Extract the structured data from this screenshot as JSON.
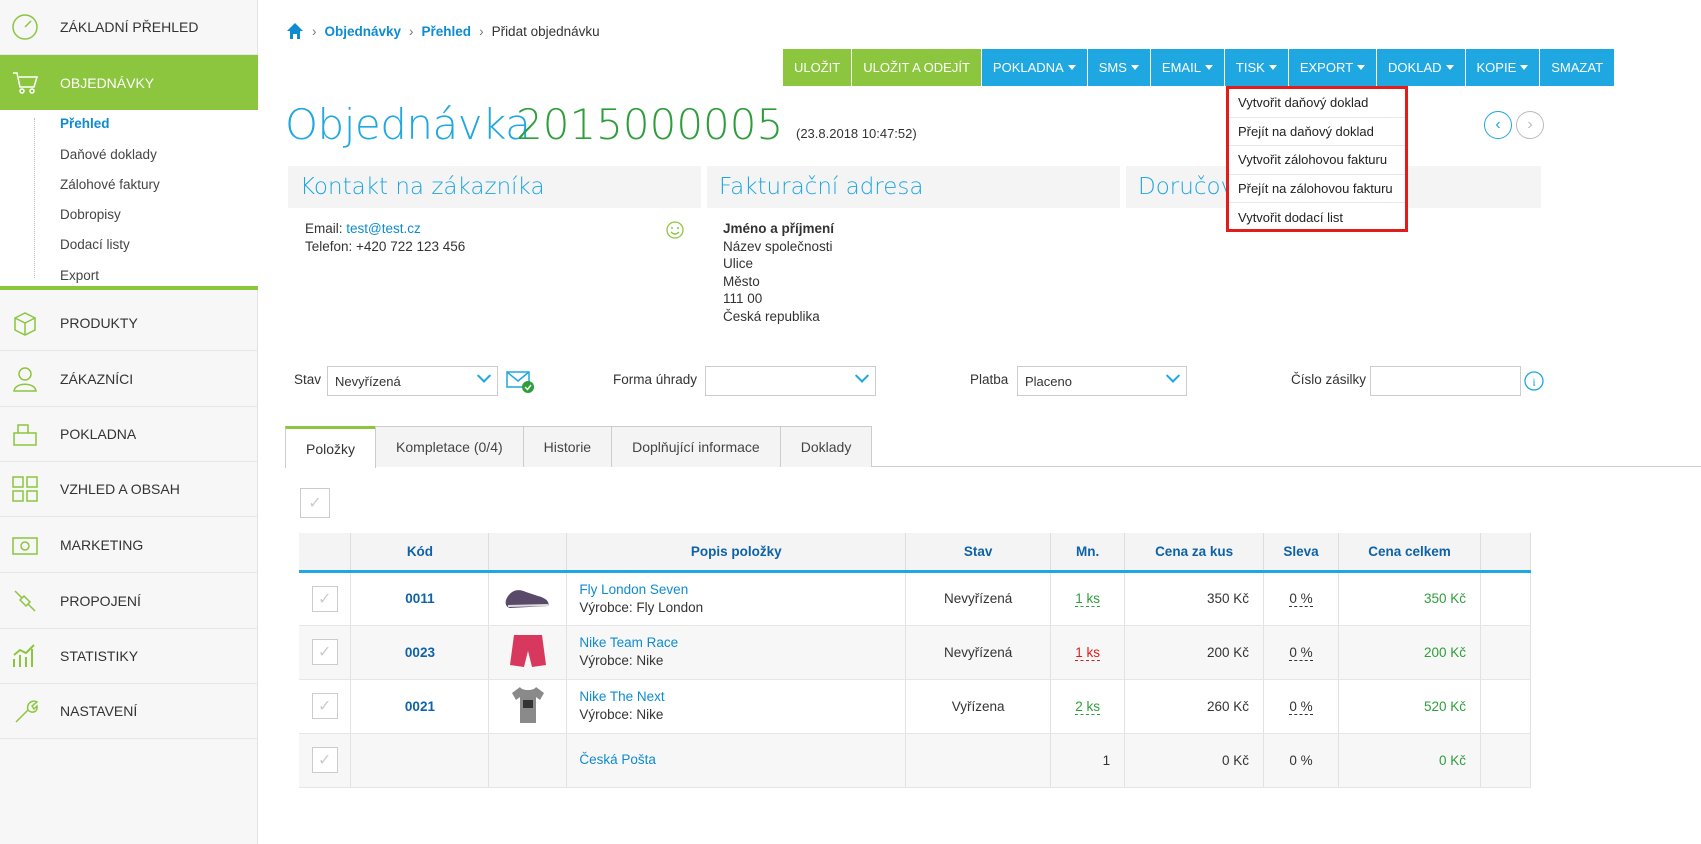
{
  "sidebar": {
    "items": [
      {
        "label": "ZÁKLADNÍ PŘEHLED",
        "icon": "gauge-icon"
      },
      {
        "label": "OBJEDNÁVKY",
        "icon": "cart-icon"
      },
      {
        "label": "PRODUKTY",
        "icon": "box-icon"
      },
      {
        "label": "ZÁKAZNÍCI",
        "icon": "user-icon"
      },
      {
        "label": "POKLADNA",
        "icon": "cash-register-icon"
      },
      {
        "label": "VZHLED A OBSAH",
        "icon": "layout-grid-icon"
      },
      {
        "label": "MARKETING",
        "icon": "money-icon"
      },
      {
        "label": "PROPOJENÍ",
        "icon": "plug-icon"
      },
      {
        "label": "STATISTIKY",
        "icon": "bar-chart-icon"
      },
      {
        "label": "NASTAVENÍ",
        "icon": "wrench-icon"
      }
    ],
    "subitems": [
      "Přehled",
      "Daňové doklady",
      "Zálohové faktury",
      "Dobropisy",
      "Dodací listy",
      "Export"
    ]
  },
  "breadcrumb": {
    "home": "home-icon",
    "items": [
      "Objednávky",
      "Přehled",
      "Přidat objednávku"
    ]
  },
  "toolbar": {
    "buttons": [
      "ULOŽIT",
      "ULOŽIT A ODEJÍT",
      "POKLADNA",
      "SMS",
      "EMAIL",
      "TISK",
      "EXPORT",
      "DOKLAD",
      "KOPIE",
      "SMAZAT"
    ]
  },
  "dropdown": {
    "items": [
      "Vytvořit daňový doklad",
      "Přejít na daňový doklad",
      "Vytvořit zálohovou fakturu",
      "Přejít na zálohovou fakturu",
      "Vytvořit dodací list"
    ]
  },
  "order": {
    "title": "Objednávka",
    "number": "2015000005",
    "date": "(23.8.2018 10:47:52)"
  },
  "panels": {
    "contact": {
      "title": "Kontakt na zákazníka",
      "email_label": "Email:",
      "email": "test@test.cz",
      "phone": "Telefon: +420 722 123 456"
    },
    "billing": {
      "title": "Fakturační adresa",
      "lines": [
        "Jméno a příjmení",
        "Název společnosti",
        "Ulice",
        "Město",
        "111 00",
        "Česká republika"
      ]
    },
    "delivery": {
      "title": "Doručov"
    }
  },
  "filters": {
    "stav_label": "Stav",
    "stav_value": "Nevyřízená",
    "forma_label": "Forma úhrady",
    "forma_value": "",
    "platba_label": "Platba",
    "platba_value": "Placeno",
    "zasilka_label": "Číslo zásilky"
  },
  "tabs": [
    "Položky",
    "Kompletace (0/4)",
    "Historie",
    "Doplňující informace",
    "Doklady"
  ],
  "table": {
    "headers": [
      "",
      "Kód",
      "",
      "Popis položky",
      "Stav",
      "Mn.",
      "Cena za kus",
      "Sleva",
      "Cena celkem",
      ""
    ],
    "rows": [
      {
        "code": "0011",
        "name": "Fly London Seven",
        "maker": "Výrobce: Fly London",
        "stav": "Nevyřízená",
        "qty": "1 ks",
        "price": "350 Kč",
        "disc": "0 %",
        "total": "350 Kč"
      },
      {
        "code": "0023",
        "name": "Nike Team Race",
        "maker": "Výrobce: Nike",
        "stav": "Nevyřízená",
        "qty": "1 ks",
        "price": "200 Kč",
        "disc": "0 %",
        "total": "200 Kč"
      },
      {
        "code": "0021",
        "name": "Nike The Next",
        "maker": "Výrobce: Nike",
        "stav": "Vyřízena",
        "qty": "2 ks",
        "price": "260 Kč",
        "disc": "0 %",
        "total": "520 Kč"
      },
      {
        "code": "",
        "name": "Česká Pošta",
        "maker": "",
        "stav": "",
        "qty": "1",
        "price": "0 Kč",
        "disc": "0 %",
        "total": "0 Kč"
      }
    ]
  },
  "colors": {
    "green": "#8cc63f",
    "blue": "#1ea7e1",
    "highlight": "#e21b1b"
  }
}
